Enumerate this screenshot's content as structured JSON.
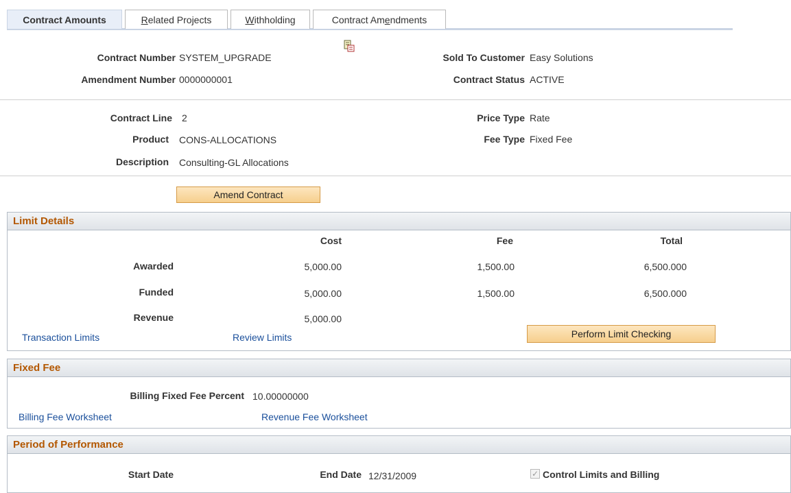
{
  "tabs": [
    {
      "pre": "Contract Amounts",
      "u": "",
      "post": ""
    },
    {
      "pre": "",
      "u": "R",
      "post": "elated Projects"
    },
    {
      "pre": "",
      "u": "W",
      "post": "ithholding"
    },
    {
      "pre": "Contract Am",
      "u": "e",
      "post": "ndments"
    }
  ],
  "header": {
    "contract_number_label": "Contract Number",
    "contract_number": "SYSTEM_UPGRADE",
    "amendment_number_label": "Amendment Number",
    "amendment_number": "0000000001",
    "sold_to_label": "Sold To Customer",
    "sold_to": "Easy Solutions",
    "status_label": "Contract Status",
    "status": "ACTIVE",
    "icon": "report-icon"
  },
  "line": {
    "contract_line_label": "Contract Line",
    "contract_line": "2",
    "product_label": "Product",
    "product": "CONS-ALLOCATIONS",
    "description_label": "Description",
    "description": "Consulting-GL Allocations",
    "price_type_label": "Price Type",
    "price_type": "Rate",
    "fee_type_label": "Fee Type",
    "fee_type": "Fixed Fee"
  },
  "amend_button": "Amend Contract",
  "limit_details": {
    "title": "Limit Details",
    "columns": [
      "Cost",
      "Fee",
      "Total"
    ],
    "rows": [
      {
        "label": "Awarded",
        "cost": "5,000.00",
        "fee": "1,500.00",
        "total": "6,500.000"
      },
      {
        "label": "Funded",
        "cost": "5,000.00",
        "fee": "1,500.00",
        "total": "6,500.000"
      },
      {
        "label": "Revenue",
        "cost": "5,000.00",
        "fee": "",
        "total": ""
      }
    ],
    "transaction_limits_link": "Transaction Limits",
    "review_limits_link": "Review Limits",
    "perform_button": "Perform Limit Checking"
  },
  "fixed_fee": {
    "title": "Fixed Fee",
    "percent_label": "Billing Fixed Fee Percent",
    "percent": "10.00000000",
    "billing_link": "Billing Fee Worksheet",
    "revenue_link": "Revenue Fee Worksheet"
  },
  "performance": {
    "title": "Period of Performance",
    "start_label": "Start Date",
    "start": "",
    "end_label": "End Date",
    "end": "12/31/2009",
    "control_label": "Control Limits and Billing",
    "control_checked": true
  }
}
